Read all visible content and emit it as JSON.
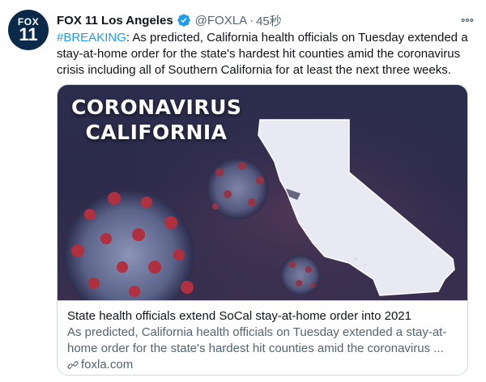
{
  "account": {
    "avatar_top": "FOX",
    "avatar_bottom": "11",
    "display_name": "FOX 11 Los Angeles",
    "handle": "@FOXLA",
    "separator": "·",
    "time": "45秒"
  },
  "tweet": {
    "hashtag": "#BREAKING",
    "text": ": As predicted, California health officials on Tuesday extended a stay-at-home order for the state's hardest hit counties amid the coronavirus crisis including all of Southern California for at least the next three weeks."
  },
  "card": {
    "image_line1": "CORONAVIRUS",
    "image_line2": "CALIFORNIA",
    "title": "State health officials extend SoCal stay-at-home order into 2021",
    "description": "As predicted, California health officials on Tuesday extended a stay-at-home order for the state's hardest hit counties amid the coronavirus ...",
    "domain": "foxla.com"
  },
  "colors": {
    "accent": "#1d9bf0",
    "secondary_text": "#536471",
    "border": "#cfd9de",
    "image_bg": "#2c2d4d"
  },
  "icons": [
    "verified-badge-icon",
    "more-options-icon",
    "link-icon"
  ]
}
